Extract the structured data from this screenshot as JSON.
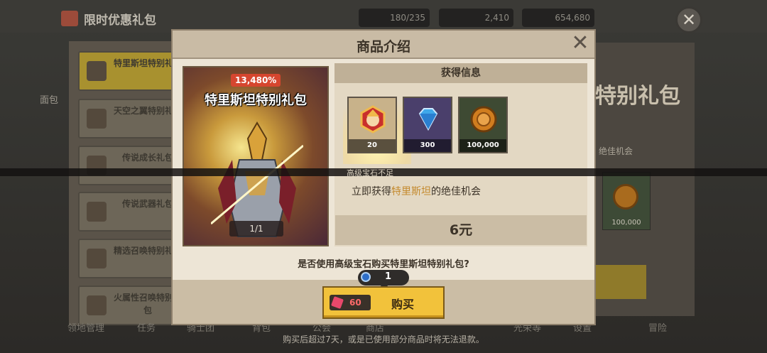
{
  "background": {
    "window_title": "限时优惠礼包",
    "resources": [
      "180/235",
      "2,410",
      "654,680"
    ],
    "side_items": [
      "特里斯坦特别礼包",
      "天空之翼特别礼包",
      "传说成长礼包",
      "传说武器礼包",
      "精选召唤特别礼包",
      "火属性召唤特别礼包"
    ],
    "left_label": "面包",
    "right_title": "特别礼包",
    "right_text": "绝佳机会",
    "right_coin_value": "100,000",
    "bottom_nav": [
      "领地管理",
      "任务",
      "骑士团",
      "背包",
      "公会",
      "商店",
      "光荣等",
      "设置",
      "冒险"
    ],
    "bottom_note": "购买后超过7天，或是已使用部分商品时将无法退款。"
  },
  "modal": {
    "title": "商品介绍",
    "close_symbol": "✕",
    "art": {
      "discount": "13,480%",
      "name": "特里斯坦特别礼包",
      "page": "1/1"
    },
    "info_header": "获得信息",
    "items": [
      {
        "icon": "hero-portrait-icon",
        "count": "20",
        "bg": "#c8b28a"
      },
      {
        "icon": "diamond-icon",
        "count": "300",
        "bg": "#4a3f6b"
      },
      {
        "icon": "gold-coin-icon",
        "count": "100,000",
        "bg": "#3e4a33"
      }
    ],
    "warning": "高级宝石不足",
    "description": {
      "prefix": "立即获得",
      "highlight": "特里斯坦",
      "suffix": "的绝佳机会"
    },
    "price": "6元",
    "confirm_text": "是否使用高级宝石购买特里斯坦特别礼包?",
    "quantity": "1",
    "buy": {
      "cost": "60",
      "label": "购买"
    }
  }
}
